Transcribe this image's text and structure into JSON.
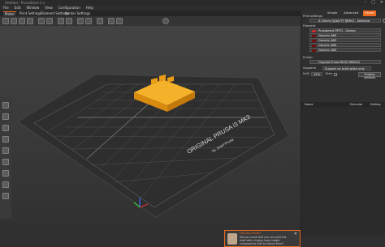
{
  "window": {
    "title": "Untitled - PrusaSlicer-2.x",
    "controls": [
      "–",
      "□",
      "✕"
    ]
  },
  "menu": [
    "File",
    "Edit",
    "Window",
    "View",
    "Configuration",
    "Help"
  ],
  "tabs": [
    "Plater",
    "Print Settings",
    "Filament Settings",
    "Printer Settings"
  ],
  "toolbar": {
    "icons": [
      "add-icon",
      "delete-icon",
      "delete-all-icon",
      "arrange-icon",
      "copy-icon",
      "paste-icon",
      "add-instance-icon",
      "remove-instance-icon",
      "split-objects-icon",
      "split-parts-icon",
      "layers-icon",
      "undo-icon",
      "redo-icon",
      "search-icon"
    ]
  },
  "mode": {
    "options": [
      "Simple",
      "Advanced",
      "Expert"
    ],
    "selected": "Expert"
  },
  "sidebar": {
    "print_settings_label": "Print settings",
    "print_profile": "0.15mm QUALITY @MK3 - Selected",
    "filament_label": "Filament",
    "filaments": [
      {
        "name": "Prusament PETG - Galaxy",
        "color": "#c0302b"
      },
      {
        "name": "Generic ABS",
        "color": "#6e1010"
      },
      {
        "name": "Generic ABS",
        "color": "#6e1010"
      },
      {
        "name": "Generic ABS",
        "color": "#6e1010"
      },
      {
        "name": "Generic ABS",
        "color": "#6e1010"
      }
    ],
    "printer_label": "Printer",
    "printer": "Original Prusa MK3S MMU2S",
    "supports_label": "Supports",
    "supports_value": "Support on build plate only",
    "infill_label": "Infill",
    "infill_value": "15%",
    "brim_label": "Brim",
    "purging_button": "Purging volumes",
    "table_headers": [
      "Name",
      "Extruder",
      "Editing"
    ]
  },
  "bed": {
    "logo_line1": "ORIGINAL PRUSA i3 MK3",
    "logo_line2": "by Josef Prusa"
  },
  "notification": {
    "header": "Did you know?",
    "text": "Did you know that you can print the shell with a higher layer height compared to infill to reduce time?",
    "close": "✕"
  },
  "colors": {
    "accent": "#ed6b21",
    "object": "#f1a31d",
    "bed": "#2e2e2e",
    "grid": "#5f5f5f"
  }
}
